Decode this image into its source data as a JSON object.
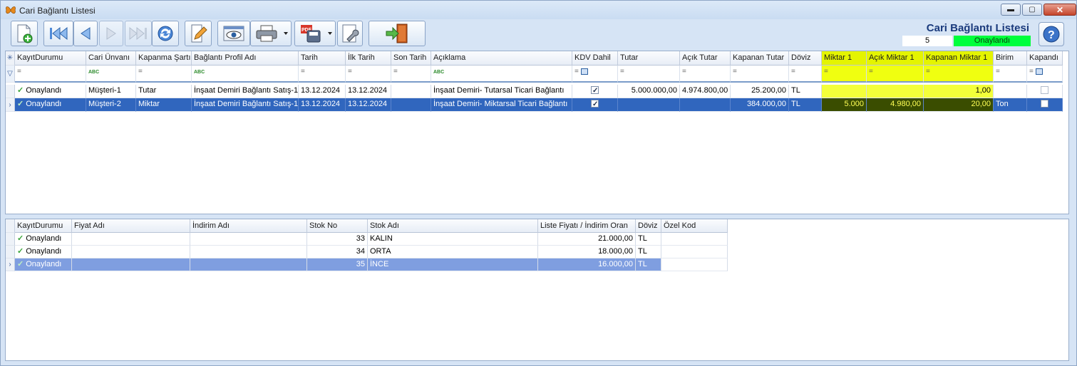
{
  "window": {
    "title": "Cari Bağlantı Listesi",
    "buttons": {
      "minimize": "▬",
      "maximize": "▢",
      "close": "✕"
    }
  },
  "header": {
    "title": "Cari Bağlantı Listesi",
    "record_number": "5",
    "status": "Onaylandı",
    "status_color": "#00ff3c"
  },
  "toolbar": {
    "icons": [
      "new-document-icon",
      "first-record-icon",
      "previous-record-icon",
      "next-record-icon",
      "last-record-icon",
      "refresh-icon",
      "edit-icon",
      "preview-icon",
      "print-icon",
      "pdf-export-icon",
      "settings-wrench-icon",
      "exit-door-icon",
      "help-icon"
    ]
  },
  "main_grid": {
    "headers": [
      "KayıtDurumu",
      "Cari Ünvanı",
      "Kapanma Şartı",
      "Bağlantı Profil Adı",
      "Tarih",
      "İlk Tarih",
      "Son Tarih",
      "Açıklama",
      "KDV Dahil",
      "Tutar",
      "Açık Tutar",
      "Kapanan Tutar",
      "Döviz",
      "Miktar 1",
      "Açık Miktar 1",
      "Kapanan Miktar 1",
      "Birim",
      "Kapandı"
    ],
    "filter_symbols": {
      "eq": "=",
      "abc": "ABC"
    },
    "rows": [
      {
        "status": "Onaylandı",
        "cari": "Müşteri-1",
        "kapanma": "Tutar",
        "profil": "İnşaat Demiri Bağlantı Satış-1",
        "tarih": "13.12.2024",
        "ilk_tarih": "13.12.2024",
        "son_tarih": "",
        "aciklama": "İnşaat Demiri- Tutarsal Ticari Bağlantı",
        "kdv": true,
        "tutar": "5.000.000,00",
        "acik_tutar": "4.974.800,00",
        "kapanan_tutar": "25.200,00",
        "doviz": "TL",
        "miktar1": "",
        "acik_miktar1": "",
        "kapanan_miktar1": "1,00",
        "birim": "",
        "kapandi": false
      },
      {
        "status": "Onaylandı",
        "cari": "Müşteri-2",
        "kapanma": "Miktar",
        "profil": "İnşaat Demiri Bağlantı Satış-1",
        "tarih": "13.12.2024",
        "ilk_tarih": "13.12.2024",
        "son_tarih": "",
        "aciklama": "İnşaat Demiri- Miktarsal Ticari Bağlantı",
        "kdv": true,
        "tutar": "",
        "acik_tutar": "",
        "kapanan_tutar": "384.000,00",
        "doviz": "TL",
        "miktar1": "5.000",
        "acik_miktar1": "4.980,00",
        "kapanan_miktar1": "20,00",
        "birim": "Ton",
        "kapandi": false
      }
    ]
  },
  "detail_grid": {
    "headers": [
      "KayıtDurumu",
      "Fiyat Adı",
      "İndirim Adı",
      "Stok No",
      "Stok Adı",
      "Liste Fiyatı / İndirim Oran",
      "Döviz",
      "Özel Kod"
    ],
    "rows": [
      {
        "status": "Onaylandı",
        "fiyat": "",
        "indirim": "",
        "stok_no": "33",
        "stok_adi": "KALIN",
        "liste_fiyati": "21.000,00",
        "doviz": "TL",
        "ozel_kod": ""
      },
      {
        "status": "Onaylandı",
        "fiyat": "",
        "indirim": "",
        "stok_no": "34",
        "stok_adi": "ORTA",
        "liste_fiyati": "18.000,00",
        "doviz": "TL",
        "ozel_kod": ""
      },
      {
        "status": "Onaylandı",
        "fiyat": "",
        "indirim": "",
        "stok_no": "35",
        "stok_adi": "İNCE",
        "liste_fiyati": "16.000,00",
        "doviz": "TL",
        "ozel_kod": ""
      }
    ]
  },
  "colors": {
    "highlight_column": "#e4f400",
    "selection": "#3066be"
  }
}
